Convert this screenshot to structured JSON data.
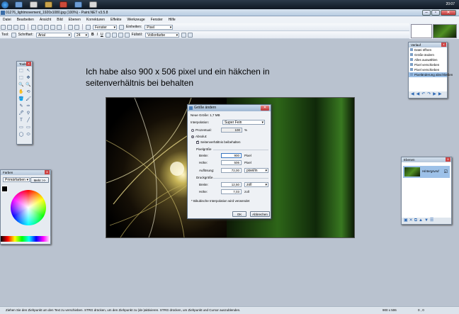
{
  "taskbar": {
    "clock": "20:07"
  },
  "window": {
    "title": "01276_lightmovement_1920x1080.jpg (100%) - Paint.NET v3.5.8"
  },
  "menu": [
    "Datei",
    "Bearbeiten",
    "Ansicht",
    "Bild",
    "Ebenen",
    "Korrekturen",
    "Effekte",
    "Werkzeuge",
    "Fenster",
    "Hilfe"
  ],
  "toolbar": {
    "window_select": "Fenster",
    "units_label": "Einheiten:",
    "units_value": "Pixel"
  },
  "toolbar2": {
    "tool_label": "Tool:",
    "font_label": "Schriftart:",
    "font_value": "Arial",
    "size_value": "24",
    "bold": "B",
    "italic": "I",
    "underline": "U",
    "fill_label": "Füllstil:",
    "fill_value": "Vollonfarbe"
  },
  "note": {
    "line1": "Ich habe also 900 x 506 pixel und ein häkchen in",
    "line2": "seitenverhältnis bei behalten"
  },
  "dialog": {
    "title": "Größe ändern",
    "new_size": "Neue Größe: 1,7 MB",
    "interp_label": "Interpolation:",
    "interp_value": "Super Fein",
    "percent_label": "Prozentual:",
    "percent_value": "100",
    "percent_unit": "%",
    "absolute_label": "Absolut:",
    "keep_ratio": "Seitenverhältnis beibehalten",
    "pixel_size": "Pixelgröße",
    "width_label": "Breite:",
    "width_value": "900",
    "width_unit": "Pixel",
    "height_label": "Höhe:",
    "height_value": "506",
    "height_unit": "Pixel",
    "res_label": "Auflösung:",
    "res_value": "72,00",
    "res_unit": "pixel/in",
    "print_size": "Druckgröße",
    "pwidth_label": "Breite:",
    "pwidth_value": "12,50",
    "pwidth_unit": "zoll",
    "pheight_label": "Höhe:",
    "pheight_value": "7,03",
    "pheight_unit": "zoll",
    "note": "* Bikubische Interpolation wird verwendet",
    "ok": "OK",
    "cancel": "Abbrechen"
  },
  "tools": {
    "title": "Tools",
    "icons": [
      "⬚",
      "↖",
      "⬚",
      "✥",
      "🔍",
      "🔍",
      "✋",
      "⟲",
      "🪣",
      "🖌",
      "✎",
      "✑",
      "🖊",
      "⚲",
      "T",
      "╱",
      "▭",
      "▭",
      "◯",
      "⬭"
    ]
  },
  "history": {
    "title": "Verlauf",
    "items": [
      "Datei öffnen",
      "Größe ändern",
      "Alles auswählen",
      "Pixel verschieben",
      "Pixel verschieben",
      "Pixeländerung abschließen"
    ],
    "selected": 5
  },
  "colors": {
    "title": "Farben",
    "mode": "Primärfarben",
    "more": "Mehr >>"
  },
  "layers": {
    "title": "Ebenen",
    "layer_name": "Hintergrund"
  },
  "status": {
    "hint": "Ziehen Sie den Ziehpunkt um den Text zu verschieben. STRG drücken, um den Ziehpunkt zu (de-)aktivieren. STRG drücken, um Ziehpunkt und Cursor auszublenden.",
    "size": "900 x 506",
    "pos": "0 , 0"
  }
}
